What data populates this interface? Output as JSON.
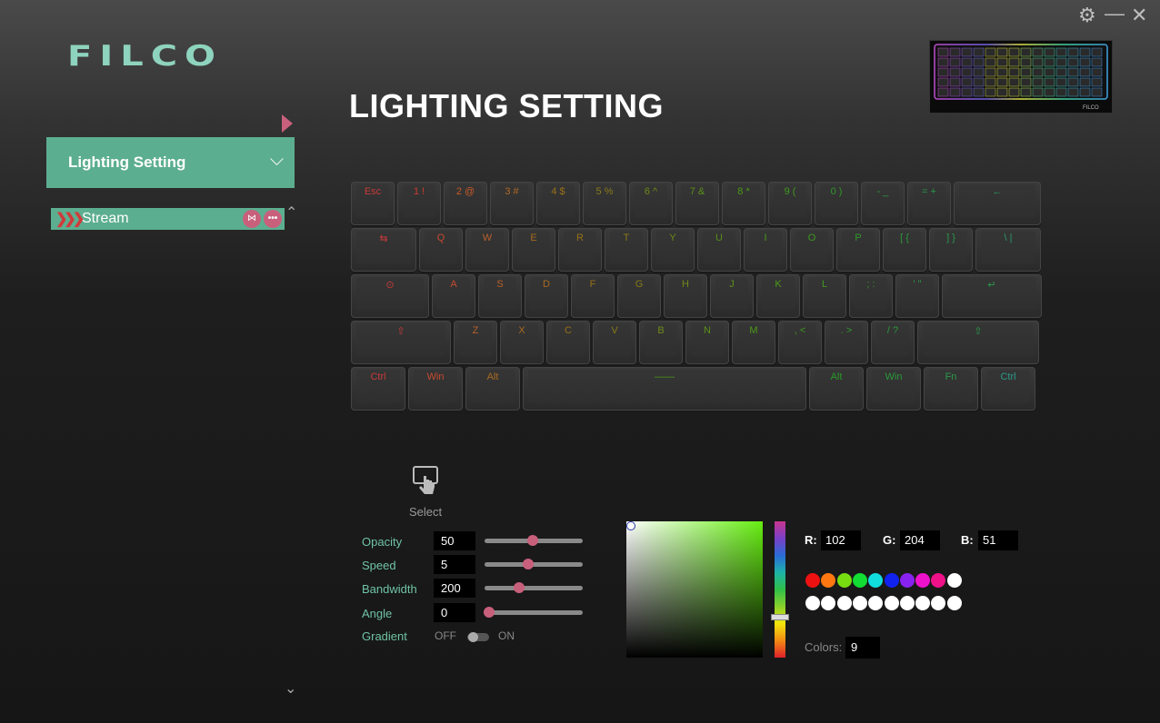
{
  "window": {
    "settings_icon": "gear-icon",
    "minimize_icon": "minimize-icon",
    "close_icon": "close-icon"
  },
  "brand": {
    "logo_text": "FILCO"
  },
  "page": {
    "title": "LIGHTING SETTING"
  },
  "sidebar": {
    "menu_label": "Lighting Setting",
    "profile": {
      "name": "Stream"
    }
  },
  "keyboard": {
    "rows": [
      [
        {
          "l": "Esc",
          "c": "#c83a3a"
        },
        {
          "l": "1 !",
          "c": "#cc3c30"
        },
        {
          "l": "2 @",
          "c": "#c85a28"
        },
        {
          "l": "3 #",
          "c": "#b06a20"
        },
        {
          "l": "4 $",
          "c": "#9a7018"
        },
        {
          "l": "5 %",
          "c": "#8a7a18"
        },
        {
          "l": "6 ^",
          "c": "#6e8a18"
        },
        {
          "l": "7 &",
          "c": "#5a9018"
        },
        {
          "l": "8 *",
          "c": "#4a9a18"
        },
        {
          "l": "9 (",
          "c": "#3e9a20"
        },
        {
          "l": "0 )",
          "c": "#2e9a2a"
        },
        {
          "l": "- _",
          "c": "#2a9a3a"
        },
        {
          "l": "= +",
          "c": "#2a9a4a"
        },
        {
          "l": "←",
          "c": "#2a9a5a"
        }
      ],
      [
        {
          "l": "⇆",
          "c": "#c83a3a"
        },
        {
          "l": "Q",
          "c": "#c84a30"
        },
        {
          "l": "W",
          "c": "#b8602a"
        },
        {
          "l": "E",
          "c": "#a86a20"
        },
        {
          "l": "R",
          "c": "#987018"
        },
        {
          "l": "T",
          "c": "#887a18"
        },
        {
          "l": "Y",
          "c": "#6e8a18"
        },
        {
          "l": "U",
          "c": "#5a9018"
        },
        {
          "l": "I",
          "c": "#4a9a18"
        },
        {
          "l": "O",
          "c": "#3e9a20"
        },
        {
          "l": "P",
          "c": "#2e9a2a"
        },
        {
          "l": "[ {",
          "c": "#2a9a3a"
        },
        {
          "l": "] }",
          "c": "#2a9a4a"
        },
        {
          "l": "\\ |",
          "c": "#2a9a6a"
        }
      ],
      [
        {
          "l": "⊙",
          "c": "#c83a3a"
        },
        {
          "l": "A",
          "c": "#c84a30"
        },
        {
          "l": "S",
          "c": "#b8602a"
        },
        {
          "l": "D",
          "c": "#a86a20"
        },
        {
          "l": "F",
          "c": "#987018"
        },
        {
          "l": "G",
          "c": "#887a18"
        },
        {
          "l": "H",
          "c": "#6e8a18"
        },
        {
          "l": "J",
          "c": "#5a9018"
        },
        {
          "l": "K",
          "c": "#4a9a18"
        },
        {
          "l": "L",
          "c": "#3e9a20"
        },
        {
          "l": "; :",
          "c": "#2e9a2a"
        },
        {
          "l": "' \"",
          "c": "#2a9a3a"
        },
        {
          "l": "↵",
          "c": "#2a9a4a"
        }
      ],
      [
        {
          "l": "⇧",
          "c": "#c83a3a"
        },
        {
          "l": "Z",
          "c": "#b8602a"
        },
        {
          "l": "X",
          "c": "#a86a20"
        },
        {
          "l": "C",
          "c": "#987018"
        },
        {
          "l": "V",
          "c": "#887a18"
        },
        {
          "l": "B",
          "c": "#6e8a18"
        },
        {
          "l": "N",
          "c": "#5a9018"
        },
        {
          "l": "M",
          "c": "#4a9a18"
        },
        {
          "l": ", <",
          "c": "#3e9a20"
        },
        {
          "l": ". >",
          "c": "#2e9a2a"
        },
        {
          "l": "/ ?",
          "c": "#2a9a3a"
        },
        {
          "l": "⇧",
          "c": "#2a9a4a"
        }
      ],
      [
        {
          "l": "Ctrl",
          "c": "#c83a3a"
        },
        {
          "l": "Win",
          "c": "#c84a30"
        },
        {
          "l": "Alt",
          "c": "#a86a20"
        },
        {
          "l": "——",
          "c": "#4a9a18"
        },
        {
          "l": "Alt",
          "c": "#2a9a2a"
        },
        {
          "l": "Win",
          "c": "#2a9a3a"
        },
        {
          "l": "Fn",
          "c": "#2a9a4a"
        },
        {
          "l": "Ctrl",
          "c": "#2a9a8a"
        }
      ]
    ]
  },
  "select": {
    "label": "Select",
    "icon": "touch-select-icon"
  },
  "params": [
    {
      "label": "Opacity",
      "value": "50",
      "pos": 0.49
    },
    {
      "label": "Speed",
      "value": "5",
      "pos": 0.44
    },
    {
      "label": "Bandwidth",
      "value": "200",
      "pos": 0.35
    },
    {
      "label": "Angle",
      "value": "0",
      "pos": 0.05
    }
  ],
  "gradient": {
    "label": "Gradient",
    "off": "OFF",
    "on": "ON",
    "enabled": false
  },
  "color": {
    "r_label": "R:",
    "r": "102",
    "g_label": "G:",
    "g": "204",
    "b_label": "B:",
    "b": "51",
    "swatches": [
      "#ee1111",
      "#ff7711",
      "#77dd11",
      "#11dd33",
      "#11dddd",
      "#1122ee",
      "#8822ee",
      "#ee11cc",
      "#ee1188",
      "#ffffff"
    ],
    "empty_swatches": [
      "#ffffff",
      "#ffffff",
      "#ffffff",
      "#ffffff",
      "#ffffff",
      "#ffffff",
      "#ffffff",
      "#ffffff",
      "#ffffff",
      "#ffffff"
    ],
    "colors_label": "Colors:",
    "colors_count": "9"
  }
}
